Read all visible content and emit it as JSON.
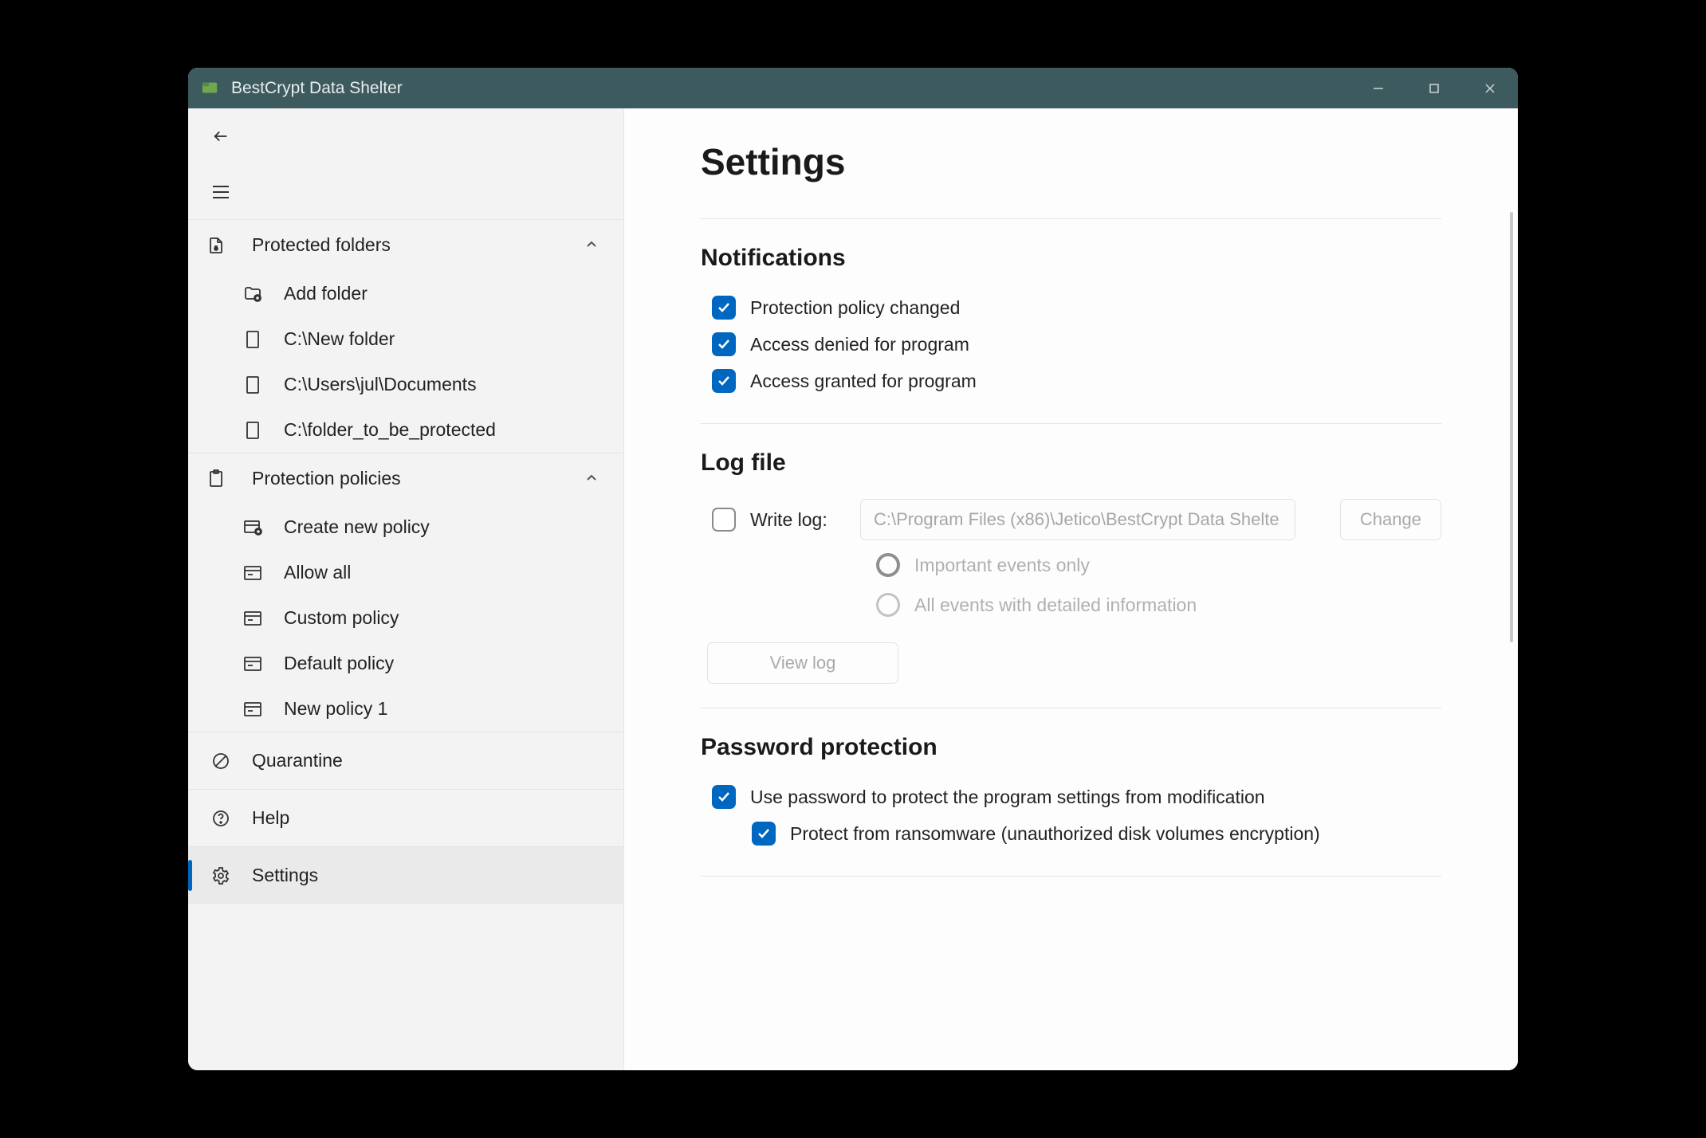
{
  "window": {
    "title": "BestCrypt Data Shelter"
  },
  "sidebar": {
    "sections": {
      "protected_folders": {
        "label": "Protected folders",
        "items": [
          {
            "label": "Add folder"
          },
          {
            "label": "C:\\New folder"
          },
          {
            "label": "C:\\Users\\jul\\Documents"
          },
          {
            "label": "C:\\folder_to_be_protected"
          }
        ]
      },
      "protection_policies": {
        "label": "Protection policies",
        "items": [
          {
            "label": "Create new policy"
          },
          {
            "label": "Allow all"
          },
          {
            "label": "Custom policy"
          },
          {
            "label": "Default policy"
          },
          {
            "label": "New policy 1"
          }
        ]
      }
    },
    "simple": {
      "quarantine": "Quarantine",
      "help": "Help",
      "settings": "Settings"
    }
  },
  "main": {
    "title": "Settings",
    "notifications": {
      "heading": "Notifications",
      "items": [
        {
          "label": "Protection policy changed",
          "checked": true
        },
        {
          "label": "Access denied for program",
          "checked": true
        },
        {
          "label": "Access granted for program",
          "checked": true
        }
      ]
    },
    "logfile": {
      "heading": "Log file",
      "write_log_label": "Write log:",
      "write_log_checked": false,
      "path_value": "C:\\Program Files (x86)\\Jetico\\BestCrypt Data Shelte",
      "change_label": "Change",
      "radio_important": "Important events only",
      "radio_all": "All events with detailed information",
      "radio_selected": "important",
      "viewlog_label": "View log"
    },
    "password": {
      "heading": "Password protection",
      "use_password_label": "Use password to protect the program settings from modification",
      "use_password_checked": true,
      "protect_ransomware_label": "Protect from ransomware (unauthorized disk volumes encryption)",
      "protect_ransomware_checked": true
    }
  }
}
